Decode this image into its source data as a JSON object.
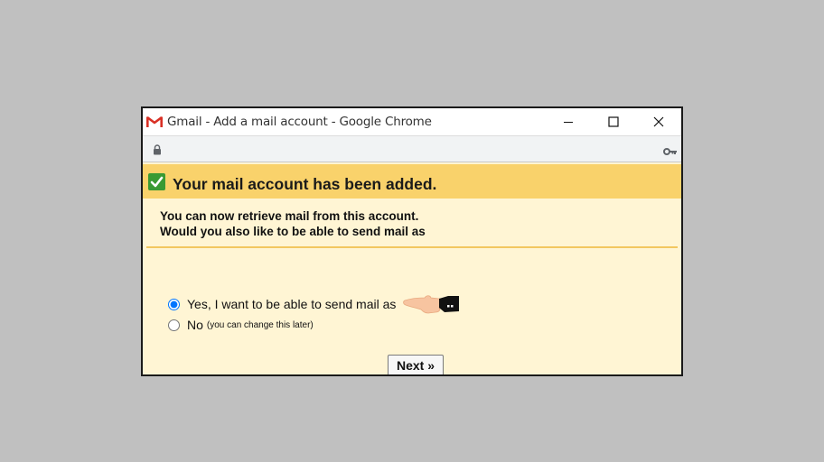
{
  "window": {
    "title": "Gmail - Add a mail account - Google Chrome"
  },
  "icons": {
    "app": "gmail-logo-icon",
    "lock": "lock-icon",
    "key": "key-icon",
    "status": "check-icon",
    "pointer": "hand-pointer-icon"
  },
  "banner": {
    "title": "Your mail account has been added."
  },
  "message": {
    "line1": "You can now retrieve mail from this account.",
    "line2": "Would you also like to be able to send mail as"
  },
  "options": [
    {
      "label": "Yes, I want to be able to send mail as",
      "note": "",
      "selected": true
    },
    {
      "label": "No",
      "note": "(you can change this later)",
      "selected": false
    }
  ],
  "next_button": {
    "label": "Next »"
  },
  "colors": {
    "banner": "#f9d26b",
    "content_bg": "#fff5d4",
    "check": "#3a9a33",
    "gmail_red": "#d93025"
  }
}
